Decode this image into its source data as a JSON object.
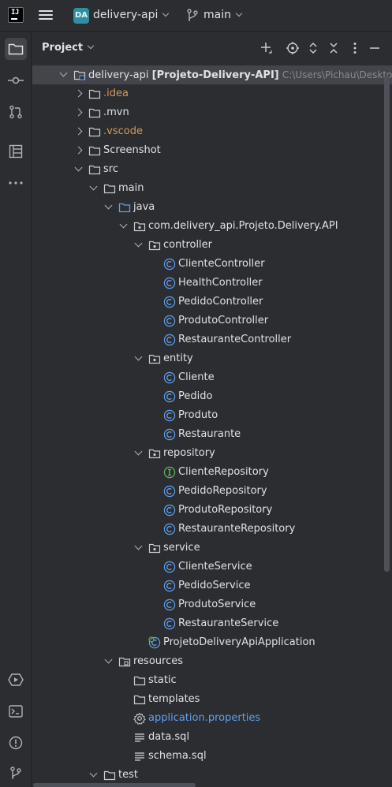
{
  "titlebar": {
    "logo_text": "IJ",
    "project_badge": "DA",
    "project_name": "delivery-api",
    "branch_name": "main"
  },
  "toolstrip": {
    "top": [
      "folder-icon",
      "commit-icon",
      "pull-requests-icon",
      "structure-icon",
      "more-icon"
    ],
    "bottom": [
      "services-icon",
      "terminal-icon",
      "problems-icon",
      "git-icon"
    ]
  },
  "panel": {
    "title": "Project"
  },
  "tree": [
    {
      "depth": 0,
      "arrow": "down",
      "icon": "module",
      "label": "delivery-api",
      "bold": "[Projeto-Delivery-API]",
      "path": "C:\\Users\\Pichau\\Desktop\\Arc",
      "selected": true
    },
    {
      "depth": 1,
      "arrow": "right",
      "icon": "folder",
      "label": ".idea",
      "color": "orange"
    },
    {
      "depth": 1,
      "arrow": "right",
      "icon": "folder",
      "label": ".mvn"
    },
    {
      "depth": 1,
      "arrow": "right",
      "icon": "folder",
      "label": ".vscode",
      "color": "orange"
    },
    {
      "depth": 1,
      "arrow": "right",
      "icon": "folder",
      "label": "Screenshot"
    },
    {
      "depth": 1,
      "arrow": "down",
      "icon": "folder",
      "label": "src"
    },
    {
      "depth": 2,
      "arrow": "down",
      "icon": "folder",
      "label": "main"
    },
    {
      "depth": 3,
      "arrow": "down",
      "icon": "folder-blue",
      "label": "java"
    },
    {
      "depth": 4,
      "arrow": "down",
      "icon": "package",
      "label": "com.delivery_api.Projeto.Delivery.API"
    },
    {
      "depth": 5,
      "arrow": "down",
      "icon": "package",
      "label": "controller"
    },
    {
      "depth": 6,
      "icon": "class",
      "label": "ClienteController"
    },
    {
      "depth": 6,
      "icon": "class",
      "label": "HealthController"
    },
    {
      "depth": 6,
      "icon": "class",
      "label": "PedidoController"
    },
    {
      "depth": 6,
      "icon": "class",
      "label": "ProdutoController"
    },
    {
      "depth": 6,
      "icon": "class",
      "label": "RestauranteController"
    },
    {
      "depth": 5,
      "arrow": "down",
      "icon": "package",
      "label": "entity"
    },
    {
      "depth": 6,
      "icon": "class",
      "label": "Cliente"
    },
    {
      "depth": 6,
      "icon": "class",
      "label": "Pedido"
    },
    {
      "depth": 6,
      "icon": "class",
      "label": "Produto"
    },
    {
      "depth": 6,
      "icon": "class",
      "label": "Restaurante"
    },
    {
      "depth": 5,
      "arrow": "down",
      "icon": "package",
      "label": "repository"
    },
    {
      "depth": 6,
      "icon": "interface",
      "label": "ClienteRepository"
    },
    {
      "depth": 6,
      "icon": "class",
      "label": "PedidoRepository"
    },
    {
      "depth": 6,
      "icon": "class",
      "label": "ProdutoRepository"
    },
    {
      "depth": 6,
      "icon": "class",
      "label": "RestauranteRepository"
    },
    {
      "depth": 5,
      "arrow": "down",
      "icon": "package",
      "label": "service"
    },
    {
      "depth": 6,
      "icon": "class",
      "label": "ClienteService"
    },
    {
      "depth": 6,
      "icon": "class",
      "label": "PedidoService"
    },
    {
      "depth": 6,
      "icon": "class",
      "label": "ProdutoService"
    },
    {
      "depth": 6,
      "icon": "class",
      "label": "RestauranteService"
    },
    {
      "depth": 5,
      "icon": "spring-class",
      "label": "ProjetoDeliveryApiApplication"
    },
    {
      "depth": 3,
      "arrow": "down",
      "icon": "folder-resources",
      "label": "resources"
    },
    {
      "depth": 4,
      "icon": "folder",
      "label": "static"
    },
    {
      "depth": 4,
      "icon": "folder",
      "label": "templates"
    },
    {
      "depth": 4,
      "icon": "gear",
      "label": "application.properties",
      "color": "blue"
    },
    {
      "depth": 4,
      "icon": "text",
      "label": "data.sql"
    },
    {
      "depth": 4,
      "icon": "text",
      "label": "schema.sql"
    },
    {
      "depth": 2,
      "arrow": "down",
      "icon": "folder",
      "label": "test"
    }
  ]
}
